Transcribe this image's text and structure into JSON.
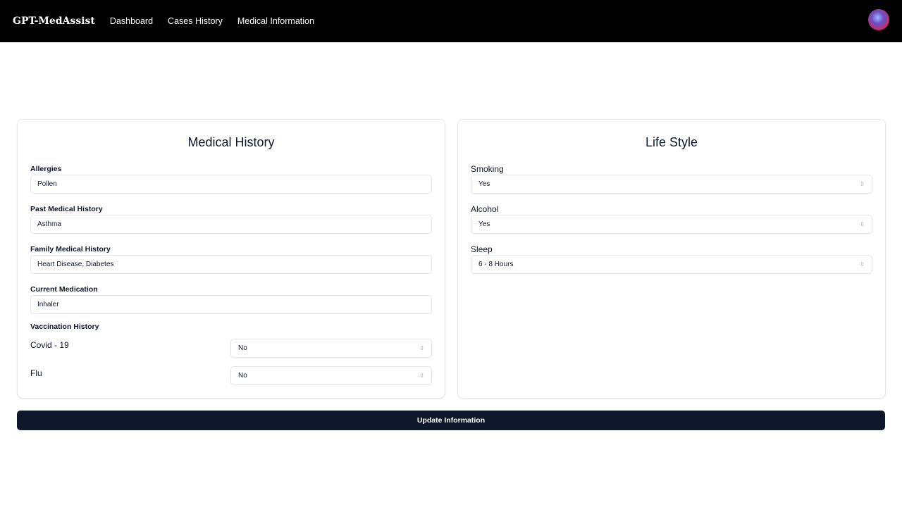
{
  "nav": {
    "brand": "GPT-MedAssist",
    "links": [
      "Dashboard",
      "Cases History",
      "Medical Information"
    ]
  },
  "medical_history": {
    "title": "Medical History",
    "fields": [
      {
        "label": "Allergies",
        "value": "Pollen"
      },
      {
        "label": "Past Medical History",
        "value": "Asthma"
      },
      {
        "label": "Family Medical History",
        "value": "Heart Disease, Diabetes"
      },
      {
        "label": "Current Medication",
        "value": "Inhaler"
      }
    ],
    "vaccination_label": "Vaccination History",
    "vaccinations": [
      {
        "label": "Covid - 19",
        "value": "No"
      },
      {
        "label": "Flu",
        "value": "No"
      }
    ]
  },
  "lifestyle": {
    "title": "Life Style",
    "fields": [
      {
        "label": "Smoking",
        "value": "Yes"
      },
      {
        "label": "Alcohol",
        "value": "Yes"
      },
      {
        "label": "Sleep",
        "value": "6 - 8 Hours"
      }
    ]
  },
  "update_button": "Update Information"
}
